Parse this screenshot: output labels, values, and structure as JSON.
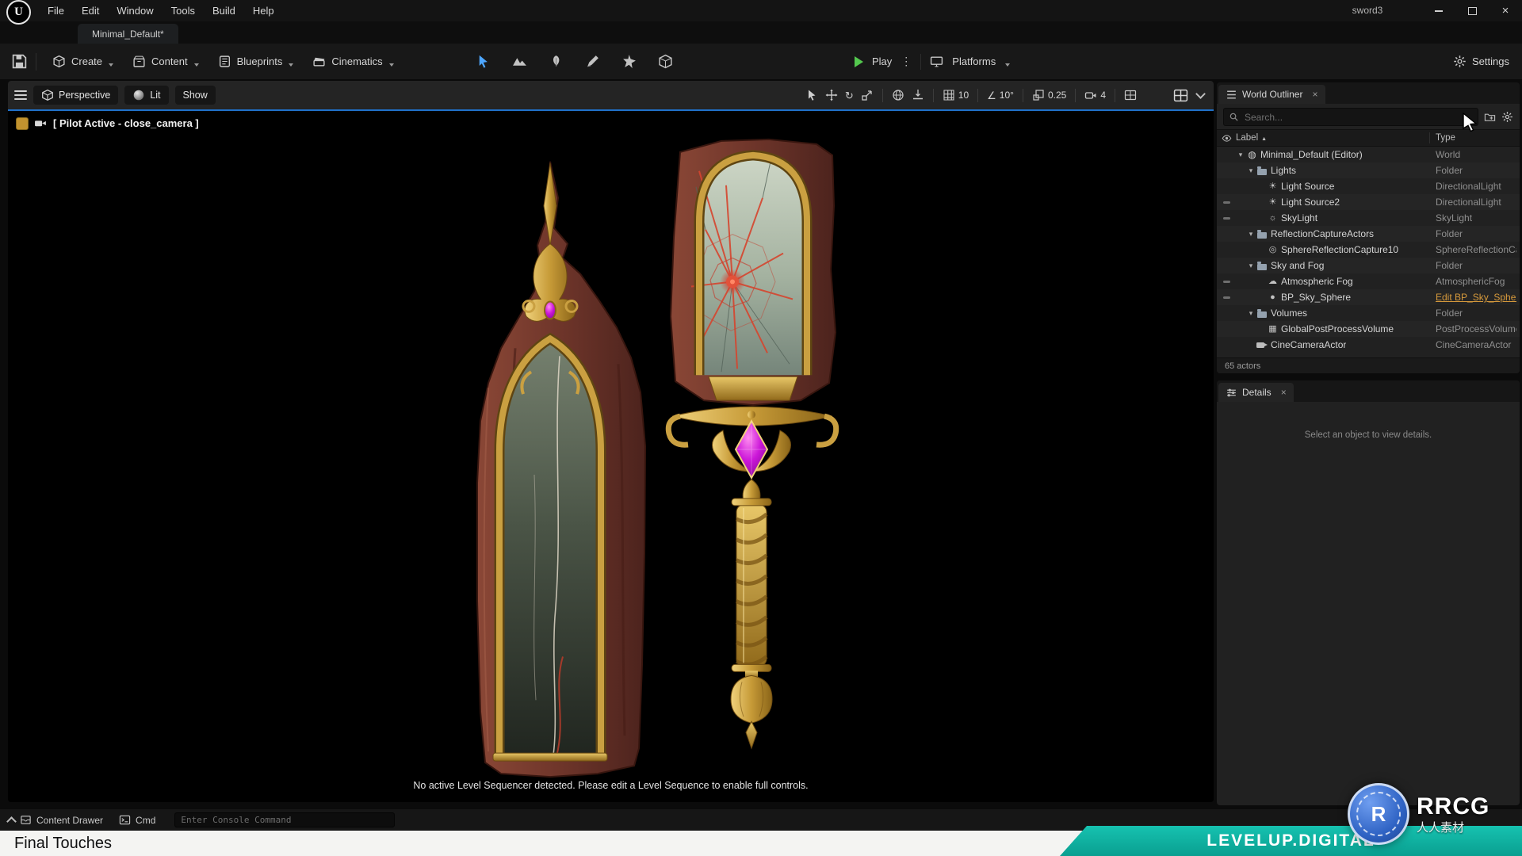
{
  "colors": {
    "accent_blue": "#2071c9",
    "play_green": "#53c84e",
    "link_orange": "#d79a3c",
    "teal_banner": "#0fb3a3",
    "gem_purple": "#cb16d8"
  },
  "window": {
    "title": "sword3",
    "menus": [
      "File",
      "Edit",
      "Window",
      "Tools",
      "Build",
      "Help"
    ]
  },
  "level_tab": {
    "label": "Minimal_Default*"
  },
  "toolbar": {
    "buttons": [
      {
        "label": "Create",
        "icon": "create"
      },
      {
        "label": "Content",
        "icon": "content"
      },
      {
        "label": "Blueprints",
        "icon": "blueprint"
      },
      {
        "label": "Cinematics",
        "icon": "clapper"
      }
    ],
    "mode_icons": [
      {
        "name": "select-mode-icon",
        "icon": "cursorB",
        "active": true
      },
      {
        "name": "landscape-mode-icon",
        "icon": "landscape",
        "active": false
      },
      {
        "name": "foliage-mode-icon",
        "icon": "foliage",
        "active": false
      },
      {
        "name": "mesh-paint-mode-icon",
        "icon": "paint",
        "active": false
      },
      {
        "name": "fracture-mode-icon",
        "icon": "fracture",
        "active": false
      },
      {
        "name": "modeling-mode-icon",
        "icon": "modeling",
        "active": false
      }
    ],
    "play_label": "Play",
    "platforms_label": "Platforms",
    "settings_label": "Settings"
  },
  "viewport": {
    "perspective_label": "Perspective",
    "lit_label": "Lit",
    "show_label": "Show",
    "pilot_label": "[ Pilot Active - close_camera ]",
    "grid_snap_value": "10",
    "rotation_snap_value": "10°",
    "scale_snap_value": "0.25",
    "camera_speed_value": "4",
    "sequencer_message": "No active Level Sequencer detected. Please edit a Level Sequence to enable full controls."
  },
  "outliner": {
    "tab_title": "World Outliner",
    "search_placeholder": "Search...",
    "label_column": "Label",
    "type_column": "Type",
    "status": "65 actors",
    "rows": [
      {
        "indent": 0,
        "expand": true,
        "icon": "world",
        "label": "Minimal_Default (Editor)",
        "type": "World",
        "eye": false,
        "type_link": false
      },
      {
        "indent": 1,
        "expand": true,
        "icon": "folder",
        "label": "Lights",
        "type": "Folder",
        "eye": false,
        "type_link": false
      },
      {
        "indent": 2,
        "expand": false,
        "icon": "dir-light",
        "label": "Light Source",
        "type": "DirectionalLight",
        "eye": false,
        "type_link": false
      },
      {
        "indent": 2,
        "expand": false,
        "icon": "dir-light",
        "label": "Light Source2",
        "type": "DirectionalLight",
        "eye": true,
        "type_link": false
      },
      {
        "indent": 2,
        "expand": false,
        "icon": "sky-light",
        "label": "SkyLight",
        "type": "SkyLight",
        "eye": true,
        "type_link": false
      },
      {
        "indent": 1,
        "expand": true,
        "icon": "folder",
        "label": "ReflectionCaptureActors",
        "type": "Folder",
        "eye": false,
        "type_link": false
      },
      {
        "indent": 2,
        "expand": false,
        "icon": "sphere-capture",
        "label": "SphereReflectionCapture10",
        "type": "SphereReflectionCapture",
        "eye": false,
        "type_link": false
      },
      {
        "indent": 1,
        "expand": true,
        "icon": "folder",
        "label": "Sky and Fog",
        "type": "Folder",
        "eye": false,
        "type_link": false
      },
      {
        "indent": 2,
        "expand": false,
        "icon": "fog",
        "label": "Atmospheric Fog",
        "type": "AtmosphericFog",
        "eye": true,
        "type_link": false
      },
      {
        "indent": 2,
        "expand": false,
        "icon": "sky-sphere",
        "label": "BP_Sky_Sphere",
        "type": "Edit BP_Sky_Sphere",
        "eye": true,
        "type_link": true
      },
      {
        "indent": 1,
        "expand": true,
        "icon": "folder",
        "label": "Volumes",
        "type": "Folder",
        "eye": false,
        "type_link": false
      },
      {
        "indent": 2,
        "expand": false,
        "icon": "volume",
        "label": "GlobalPostProcessVolume",
        "type": "PostProcessVolume",
        "eye": false,
        "type_link": false
      },
      {
        "indent": 1,
        "expand": false,
        "icon": "cine-camera",
        "label": "CineCameraActor",
        "type": "CineCameraActor",
        "eye": false,
        "type_link": false
      }
    ]
  },
  "details": {
    "tab_title": "Details",
    "empty_message": "Select an object to view details."
  },
  "statusbar": {
    "content_drawer_label": "Content Drawer",
    "cmd_label": "Cmd",
    "console_placeholder": "Enter Console Command"
  },
  "footer": {
    "caption": "Final Touches"
  },
  "watermarks": {
    "rrcg": "RRCG",
    "rrcg_initial": "R",
    "rrcg_sub": "人人素材",
    "levelup": "LEVELUP.DIGITAL"
  },
  "icon_glyphs": {
    "expander": "▾",
    "sort_asc": "▲",
    "close": "×",
    "kebab": "⋮",
    "rotate": "↻",
    "angle": "∠",
    "world": "◍",
    "dir-light": "☀",
    "sky-light": "☼",
    "sphere-capture": "◎",
    "fog": "☁",
    "sky-sphere": "●",
    "volume": "▦",
    "folder": "",
    "cine-camera": ""
  }
}
